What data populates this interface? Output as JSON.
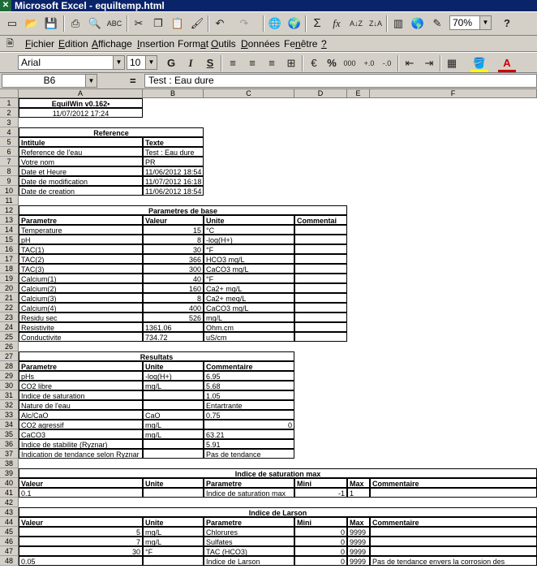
{
  "window": {
    "title": "Microsoft Excel - equiltemp.html"
  },
  "toolbar": {
    "zoom": "70%",
    "icons": [
      "new-icon",
      "open-icon",
      "save-icon",
      "print-icon",
      "print-preview-icon",
      "spelling-icon",
      "cut-icon",
      "copy-icon",
      "paste-icon",
      "format-painter-icon",
      "undo-icon",
      "redo-icon",
      "insert-hyperlink-icon",
      "web-toolbar-icon",
      "autosum-icon",
      "function-icon",
      "sort-ascending-icon",
      "sort-descending-icon",
      "chart-wizard-icon",
      "map-icon",
      "drawing-icon",
      "help-icon"
    ]
  },
  "menubar": {
    "items": [
      "Fichier",
      "Edition",
      "Affichage",
      "Insertion",
      "Format",
      "Outils",
      "Données",
      "Fenêtre",
      "?"
    ],
    "access": [
      "F",
      "E",
      "A",
      "I",
      "a",
      "O",
      "D",
      "n",
      "?"
    ]
  },
  "format": {
    "font": "Arial",
    "size": "10",
    "bold": "G",
    "italic": "I",
    "underline": "S",
    "percent": "%",
    "thousands": "000"
  },
  "formula_bar": {
    "cell_ref": "B6",
    "equals": "=",
    "content": "Test : Eau dure"
  },
  "sheet": {
    "columns": [
      "A",
      "B",
      "C",
      "D",
      "E",
      "F"
    ],
    "rows": [
      "1",
      "2",
      "3",
      "4",
      "5",
      "6",
      "7",
      "8",
      "9",
      "10",
      "11",
      "12",
      "13",
      "14",
      "15",
      "16",
      "17",
      "18",
      "19",
      "20",
      "21",
      "22",
      "23",
      "24",
      "25",
      "26",
      "27",
      "28",
      "29",
      "30",
      "31",
      "32",
      "33",
      "34",
      "35",
      "36",
      "37",
      "38",
      "39",
      "40",
      "41",
      "42",
      "43",
      "44",
      "45",
      "46",
      "47",
      "48"
    ],
    "cells": {
      "a1": "EquilWin v0.162•",
      "a2": "11/07/2012 17:24",
      "a4": "Reference",
      "a5": "Intitule",
      "b5": "Texte",
      "a6": "Reference de l'eau",
      "b6": "Test : Eau dure",
      "a7": "Votre nom",
      "b7": "PR",
      "a8": "Date et Heure",
      "b8": "11/06/2012 18:54",
      "a9": "Date de modification",
      "b9": "11/07/2012 16:18",
      "a10": "Date de creation",
      "b10": "11/06/2012 18:54",
      "a12": "Parametres de base",
      "a13": "Parametre",
      "b13": "Valeur",
      "c13": "Unite",
      "d13": "Commentai",
      "a14": "Temperature",
      "b14": "15",
      "c14": "°C",
      "a15": "pH",
      "b15": "8",
      "c15": "-log(H+)",
      "a16": "TAC(1)",
      "b16": "30",
      "c16": "°F",
      "a17": "TAC(2)",
      "b17": "366",
      "c17": "HCO3 mg/L",
      "a18": "TAC(3)",
      "b18": "300",
      "c18": "CaCO3 mg/L",
      "a19": "Calcium(1)",
      "b19": "40",
      "c19": "°F",
      "a20": "Calcium(2)",
      "b20": "160",
      "c20": "Ca2+ mg/L",
      "a21": "Calcium(3)",
      "b21": "8",
      "c21": "Ca2+ meq/L",
      "a22": "Calcium(4)",
      "b22": "400",
      "c22": "CaCO3 mg/L",
      "a23": "Residu sec",
      "b23": "526",
      "c23": "mg/L",
      "a24": "Resistivite",
      "b24": "1361.06",
      "c24": "Ohm.cm",
      "a25": "Conductivite",
      "b25": "734.72",
      "c25": "uS/cm",
      "a27": "Resultats",
      "a28": "Parametre",
      "b28": "Unite",
      "c28": "Commentaire",
      "a29": "pHs",
      "b29": "-log(H+)",
      "c29": "6.95",
      "a30": "CO2 libre",
      "b30": "mg/L",
      "c30": "5.68",
      "a31": "Indice de saturation",
      "c31": "1.05",
      "a32": "Nature de l'eau",
      "c32": "Entartrante",
      "a33": "Alc/CaO",
      "b33": "CaO",
      "c33": "0.75",
      "a34": "CO2 agressif",
      "b34": "mg/L",
      "c34": "0",
      "a35": "CaCO3",
      "b35": "mg/L",
      "c35": "63.21",
      "a36": "Indice de stabilite (Ryznar)",
      "c36": "5.91",
      "a37": "Indication de tendance selon Ryznar",
      "c37": "Pas de tendance",
      "a39": "Indice de saturation max",
      "a40": "Valeur",
      "b40": "Unite",
      "c40": "Parametre",
      "d40": "Mini",
      "e40": "Max",
      "f40": "Commentaire",
      "a41": "0.1",
      "c41": "Indice de saturation max",
      "d41": "-1",
      "e41": "1",
      "a43": "Indice de Larson",
      "a44": "Valeur",
      "b44": "Unite",
      "c44": "Parametre",
      "d44": "Mini",
      "e44": "Max",
      "f44": "Commentaire",
      "a45": "5",
      "b45": "mg/L",
      "c45": "Chlorures",
      "d45": "0",
      "e45": "9999",
      "a46": "7",
      "b46": "mg/L",
      "c46": "Sulfates",
      "d46": "0",
      "e46": "9999",
      "a47": "30",
      "b47": "°F",
      "c47": "TAC (HCO3)",
      "d47": "0",
      "e47": "9999",
      "a48": "0.05",
      "c48": "Indice de Larson",
      "d48": "0",
      "e48": "9999",
      "f48": "Pas de tendance envers la corrosion des"
    }
  }
}
